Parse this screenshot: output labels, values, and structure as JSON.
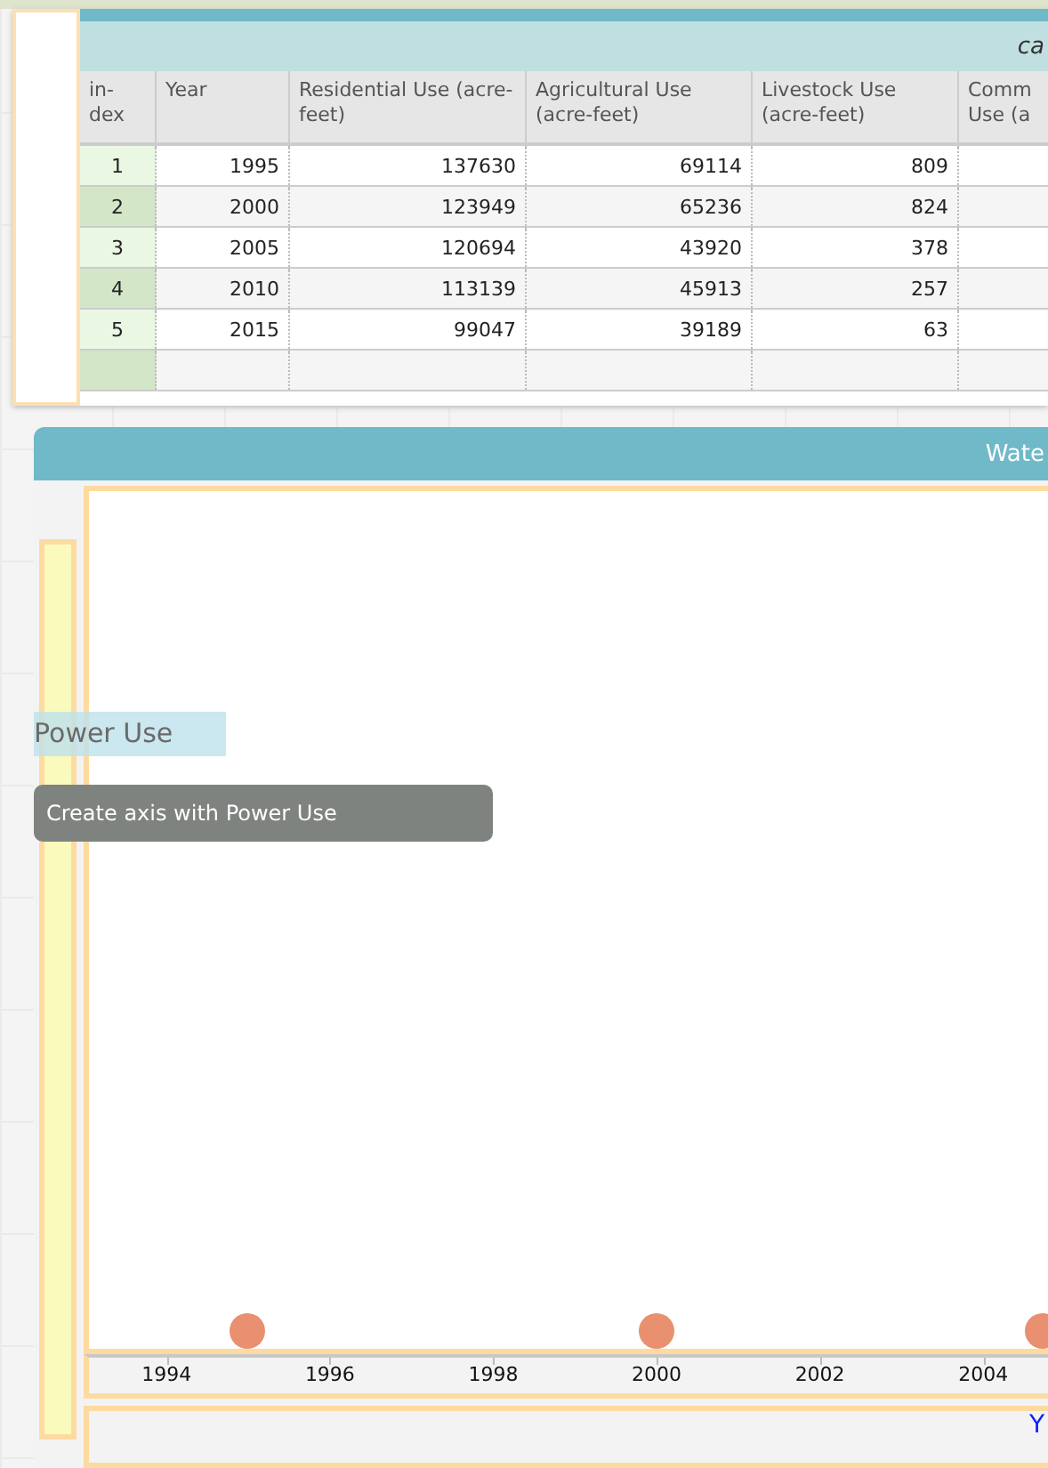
{
  "table_card": {
    "title": "ca",
    "columns": [
      "in-dex",
      "Year",
      "Residential Use (acre-feet)",
      "Agricultural Use (acre-feet)",
      "Livestock Use (acre-feet)",
      "Comm Use (a"
    ],
    "rows": [
      [
        "1",
        "1995",
        "137630",
        "69114",
        "809",
        ""
      ],
      [
        "2",
        "2000",
        "123949",
        "65236",
        "824",
        ""
      ],
      [
        "3",
        "2005",
        "120694",
        "43920",
        "378",
        ""
      ],
      [
        "4",
        "2010",
        "113139",
        "45913",
        "257",
        ""
      ],
      [
        "5",
        "2015",
        "99047",
        "39189",
        "63",
        ""
      ],
      [
        "",
        "",
        "",
        "",
        "",
        ""
      ]
    ]
  },
  "graph_card": {
    "title": "Wate",
    "drag_label": "Power Use",
    "tooltip": "Create axis with Power Use",
    "x_ticks": [
      "1994",
      "1996",
      "1998",
      "2000",
      "2002",
      "2004"
    ],
    "points": [
      {
        "level": 0.166,
        "color": "#e8906f"
      },
      {
        "level": 0.592,
        "color": "#e8906f"
      },
      {
        "level": 0.995,
        "color": "#e8906f"
      }
    ],
    "bottom_axis_label": "Y"
  }
}
